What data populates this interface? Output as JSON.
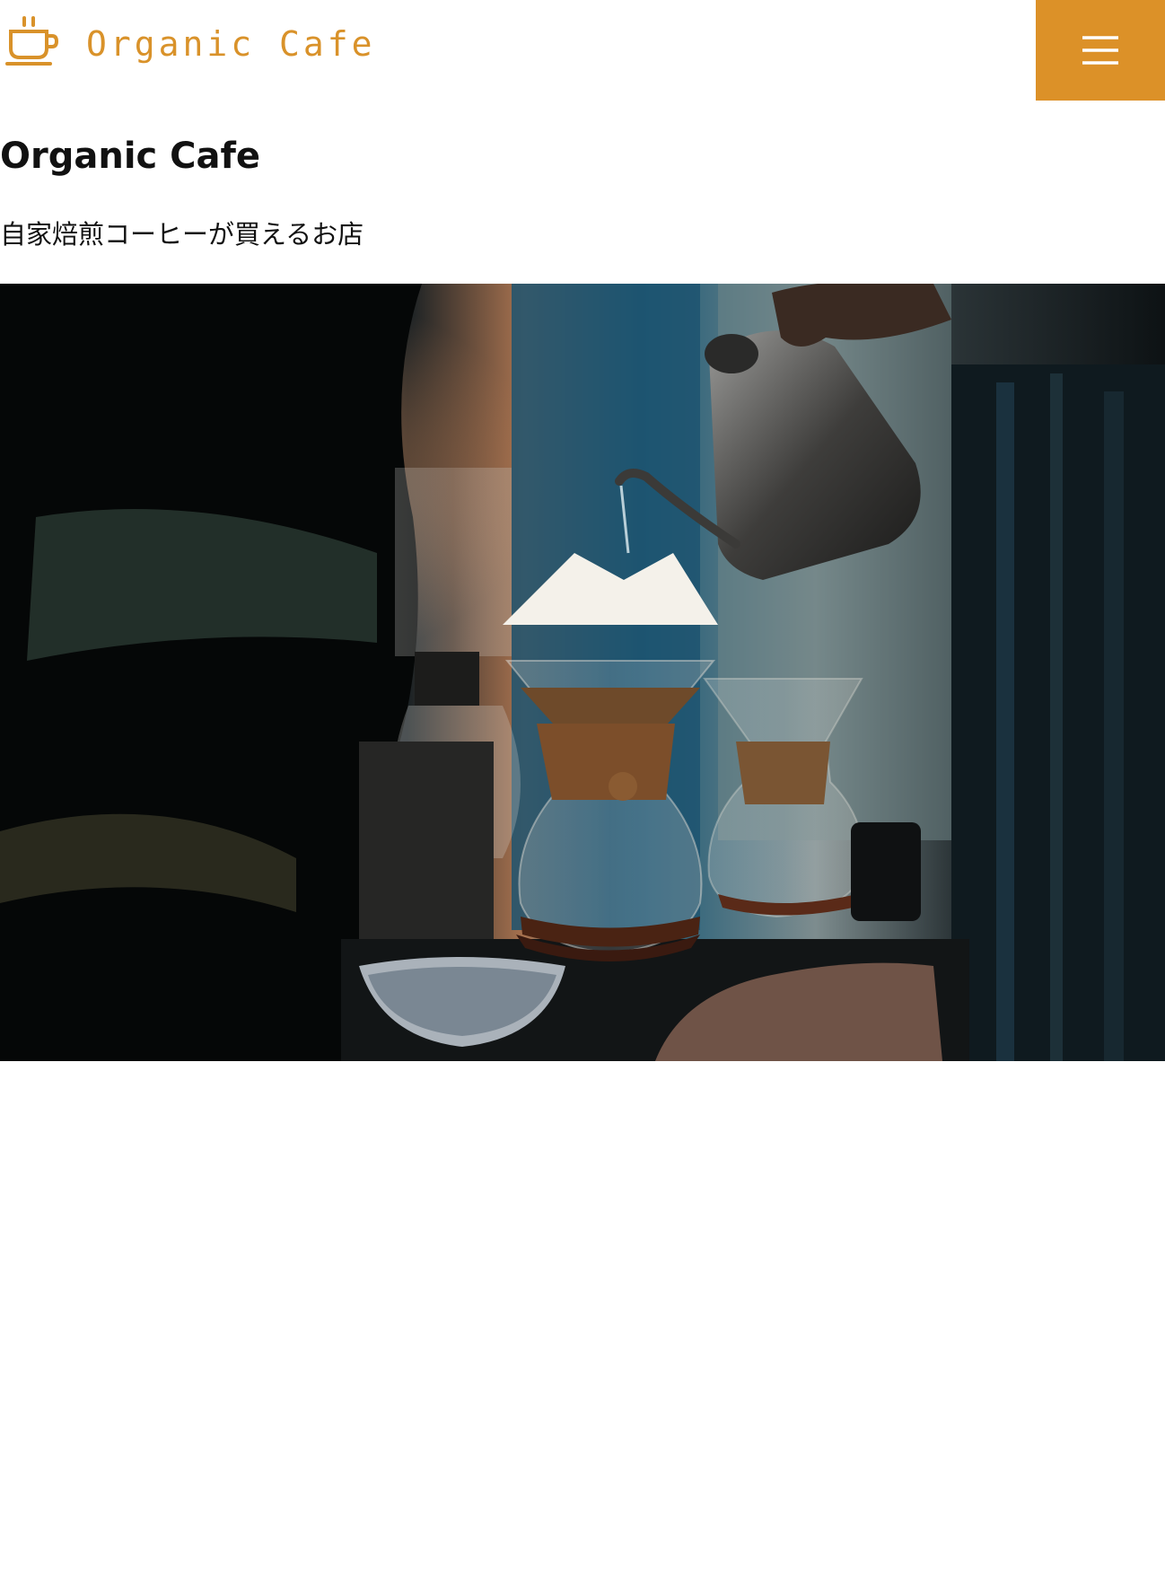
{
  "header": {
    "logo_text": "Organic Cafe",
    "logo_icon": "coffee-cup-icon",
    "menu_icon": "hamburger-menu-icon",
    "accent_color": "#dc9128"
  },
  "main": {
    "title": "Organic Cafe",
    "tagline": "自家焙煎コーヒーが買えるお店",
    "hero_image": "pour-over coffee brewing photo"
  }
}
